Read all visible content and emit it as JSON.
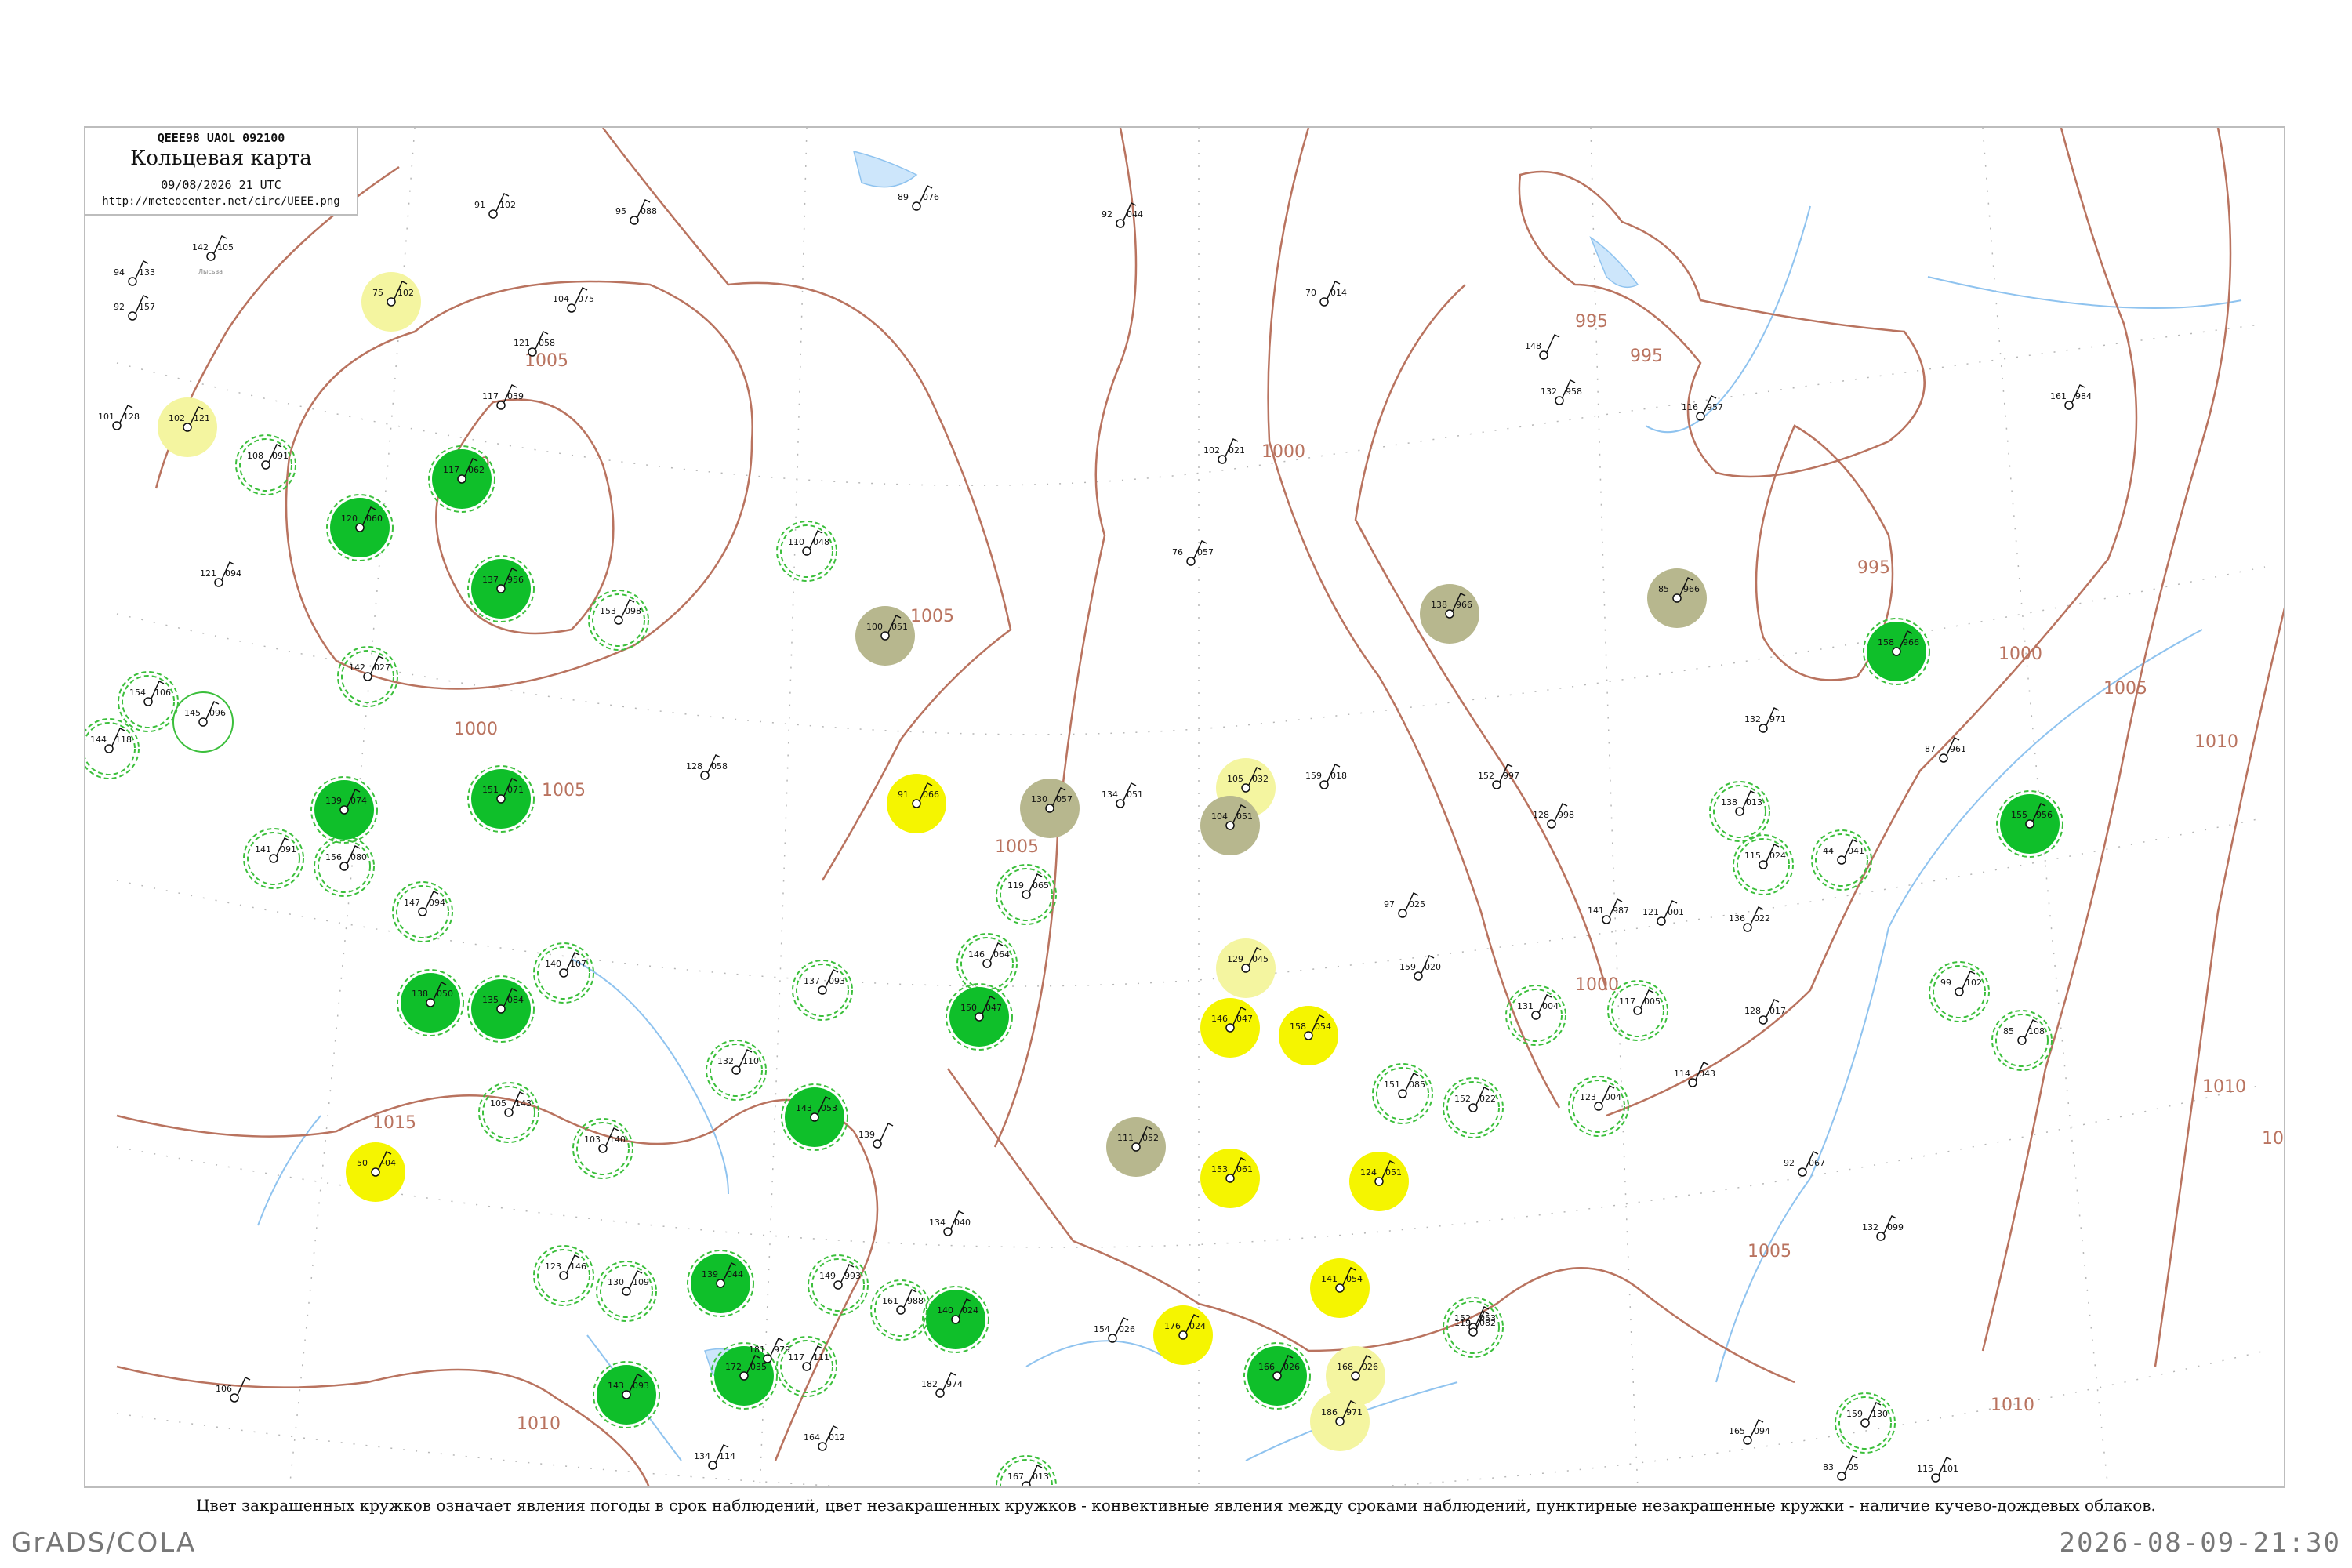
{
  "header": {
    "code_line": "QEEE98  UAOL  092100",
    "title": "Кольцевая карта",
    "date": "09/08/2026 21 UTC",
    "url": "http://meteocenter.net/circ/UEEE.png"
  },
  "caption": "Цвет закрашенных кружков означает явления погоды в срок наблюдений, цвет незакрашенных кружков - конвективные явления между сроками наблюдений, пунктирные незакрашенные кружки - наличие кучево-дождевых облаков.",
  "footer": {
    "left": "GrADS/COLA",
    "right": "2026-08-09-21:30"
  },
  "colors": {
    "isobar": "#b9735f",
    "river": "#8fc3ef",
    "rain_green": "#0fbf2a",
    "fog_olive": "#b7b78e",
    "haze_yellow": "#f5f500",
    "pale_yellow": "#f4f5a0",
    "convective_ring": "#3cbf3c"
  },
  "isobar_labels": [
    "1005",
    "1000",
    "1000",
    "1005",
    "1005",
    "1005",
    "1000",
    "1000",
    "995",
    "995",
    "995",
    "1000",
    "1005",
    "1010",
    "1015",
    "1010",
    "1010",
    "1005",
    "1010",
    "101"
  ],
  "stations": [
    {
      "t": "91",
      "p": "102",
      "name": "",
      "kind": "none"
    },
    {
      "t": "95",
      "p": "088",
      "name": "",
      "kind": "none"
    },
    {
      "t": "89",
      "p": "076",
      "name": "",
      "kind": "none"
    },
    {
      "t": "92",
      "p": "044",
      "name": "",
      "kind": "none"
    },
    {
      "t": "142",
      "p": "105",
      "name": "Лысьва",
      "kind": "none"
    },
    {
      "t": "94",
      "p": "133",
      "name": "",
      "kind": "none"
    },
    {
      "t": "92",
      "p": "157",
      "name": "",
      "kind": "none"
    },
    {
      "t": "75",
      "p": "102",
      "name": "",
      "kind": "yellow-pale"
    },
    {
      "t": "104",
      "p": "075",
      "name": "",
      "kind": "none"
    },
    {
      "t": "121",
      "p": "058",
      "name": "",
      "kind": "none"
    },
    {
      "t": "70",
      "p": "014",
      "name": "",
      "kind": "none"
    },
    {
      "t": "148",
      "p": "",
      "name": "",
      "kind": "none"
    },
    {
      "t": "132",
      "p": "958",
      "name": "",
      "kind": "none"
    },
    {
      "t": "116",
      "p": "957",
      "name": "",
      "kind": "none"
    },
    {
      "t": "161",
      "p": "984",
      "name": "",
      "kind": "none"
    },
    {
      "t": "101",
      "p": "128",
      "name": "",
      "kind": "none"
    },
    {
      "t": "102",
      "p": "121",
      "name": "",
      "kind": "yellow-pale"
    },
    {
      "t": "108",
      "p": "091",
      "name": "",
      "kind": "ring-dash"
    },
    {
      "t": "117",
      "p": "039",
      "name": "",
      "kind": "none"
    },
    {
      "t": "117",
      "p": "062",
      "name": "",
      "kind": "green"
    },
    {
      "t": "120",
      "p": "060",
      "name": "",
      "kind": "green"
    },
    {
      "t": "137",
      "p": "956",
      "name": "",
      "kind": "green"
    },
    {
      "t": "110",
      "p": "048",
      "name": "",
      "kind": "ring-dash"
    },
    {
      "t": "100",
      "p": "051",
      "name": "",
      "kind": "olive"
    },
    {
      "t": "76",
      "p": "057",
      "name": "",
      "kind": "none"
    },
    {
      "t": "102",
      "p": "021",
      "name": "",
      "kind": "none"
    },
    {
      "t": "138",
      "p": "966",
      "name": "",
      "kind": "olive"
    },
    {
      "t": "85",
      "p": "966",
      "name": "",
      "kind": "olive"
    },
    {
      "t": "158",
      "p": "966",
      "name": "",
      "kind": "green"
    },
    {
      "t": "153",
      "p": "098",
      "name": "",
      "kind": "ring-dash"
    },
    {
      "t": "121",
      "p": "094",
      "name": "",
      "kind": "none"
    },
    {
      "t": "142",
      "p": "027",
      "name": "",
      "kind": "ring-dash"
    },
    {
      "t": "145",
      "p": "096",
      "name": "",
      "kind": "ring"
    },
    {
      "t": "144",
      "p": "118",
      "name": "",
      "kind": "ring-dash"
    },
    {
      "t": "154",
      "p": "106",
      "name": "",
      "kind": "ring-dash"
    },
    {
      "t": "128",
      "p": "058",
      "name": "",
      "kind": "none"
    },
    {
      "t": "91",
      "p": "066",
      "name": "",
      "kind": "yellow"
    },
    {
      "t": "130",
      "p": "057",
      "name": "",
      "kind": "olive"
    },
    {
      "t": "134",
      "p": "051",
      "name": "",
      "kind": "none"
    },
    {
      "t": "105",
      "p": "032",
      "name": "",
      "kind": "yellow-pale"
    },
    {
      "t": "104",
      "p": "051",
      "name": "",
      "kind": "olive"
    },
    {
      "t": "159",
      "p": "018",
      "name": "",
      "kind": "none"
    },
    {
      "t": "152",
      "p": "997",
      "name": "",
      "kind": "none"
    },
    {
      "t": "132",
      "p": "971",
      "name": "",
      "kind": "none"
    },
    {
      "t": "87",
      "p": "961",
      "name": "",
      "kind": "none"
    },
    {
      "t": "128",
      "p": "998",
      "name": "",
      "kind": "none"
    },
    {
      "t": "138",
      "p": "013",
      "name": "",
      "kind": "ring-dash"
    },
    {
      "t": "115",
      "p": "024",
      "name": "",
      "kind": "ring-dash"
    },
    {
      "t": "44",
      "p": "041",
      "name": "",
      "kind": "ring-dash"
    },
    {
      "t": "155",
      "p": "956",
      "name": "",
      "kind": "green"
    },
    {
      "t": "151",
      "p": "071",
      "name": "",
      "kind": "green"
    },
    {
      "t": "141",
      "p": "091",
      "name": "",
      "kind": "ring-dash"
    },
    {
      "t": "156",
      "p": "080",
      "name": "",
      "kind": "ring-dash"
    },
    {
      "t": "139",
      "p": "074",
      "name": "",
      "kind": "green"
    },
    {
      "t": "147",
      "p": "094",
      "name": "",
      "kind": "ring-dash"
    },
    {
      "t": "119",
      "p": "065",
      "name": "",
      "kind": "ring-dash"
    },
    {
      "t": "146",
      "p": "064",
      "name": "",
      "kind": "ring-dash"
    },
    {
      "t": "129",
      "p": "045",
      "name": "",
      "kind": "yellow-pale"
    },
    {
      "t": "159",
      "p": "020",
      "name": "",
      "kind": "none"
    },
    {
      "t": "97",
      "p": "025",
      "name": "",
      "kind": "none"
    },
    {
      "t": "141",
      "p": "987",
      "name": "",
      "kind": "none"
    },
    {
      "t": "121",
      "p": "001",
      "name": "",
      "kind": "none"
    },
    {
      "t": "136",
      "p": "022",
      "name": "",
      "kind": "none"
    },
    {
      "t": "99",
      "p": "102",
      "name": "",
      "kind": "ring-dash"
    },
    {
      "t": "140",
      "p": "107",
      "name": "",
      "kind": "ring-dash"
    },
    {
      "t": "138",
      "p": "050",
      "name": "",
      "kind": "green"
    },
    {
      "t": "135",
      "p": "084",
      "name": "",
      "kind": "green"
    },
    {
      "t": "137",
      "p": "093",
      "name": "",
      "kind": "ring-dash"
    },
    {
      "t": "150",
      "p": "047",
      "name": "",
      "kind": "green"
    },
    {
      "t": "146",
      "p": "047",
      "name": "",
      "kind": "yellow"
    },
    {
      "t": "158",
      "p": "054",
      "name": "",
      "kind": "yellow"
    },
    {
      "t": "131",
      "p": "004",
      "name": "",
      "kind": "ring-dash"
    },
    {
      "t": "117",
      "p": "005",
      "name": "",
      "kind": "ring-dash"
    },
    {
      "t": "128",
      "p": "017",
      "name": "",
      "kind": "none"
    },
    {
      "t": "85",
      "p": "108",
      "name": "",
      "kind": "ring-dash"
    },
    {
      "t": "132",
      "p": "110",
      "name": "",
      "kind": "ring-dash"
    },
    {
      "t": "143",
      "p": "053",
      "name": "",
      "kind": "green"
    },
    {
      "t": "151",
      "p": "085",
      "name": "",
      "kind": "ring-dash"
    },
    {
      "t": "152",
      "p": "022",
      "name": "",
      "kind": "ring-dash"
    },
    {
      "t": "123",
      "p": "004",
      "name": "",
      "kind": "ring-dash"
    },
    {
      "t": "114",
      "p": "043",
      "name": "",
      "kind": "none"
    },
    {
      "t": "105",
      "p": "143",
      "name": "",
      "kind": "ring-dash"
    },
    {
      "t": "103",
      "p": "140",
      "name": "",
      "kind": "ring-dash"
    },
    {
      "t": "111",
      "p": "052",
      "name": "",
      "kind": "olive"
    },
    {
      "t": "153",
      "p": "061",
      "name": "",
      "kind": "yellow"
    },
    {
      "t": "124",
      "p": "051",
      "name": "",
      "kind": "yellow"
    },
    {
      "t": "92",
      "p": "067",
      "name": "",
      "kind": "none"
    },
    {
      "t": "132",
      "p": "099",
      "name": "",
      "kind": "none"
    },
    {
      "t": "50",
      "p": "-04",
      "name": "",
      "kind": "yellow"
    },
    {
      "t": "139",
      "p": "",
      "name": "",
      "kind": "none"
    },
    {
      "t": "134",
      "p": "040",
      "name": "",
      "kind": "none"
    },
    {
      "t": "123",
      "p": "146",
      "name": "",
      "kind": "ring-dash"
    },
    {
      "t": "130",
      "p": "109",
      "name": "",
      "kind": "ring-dash"
    },
    {
      "t": "139",
      "p": "044",
      "name": "",
      "kind": "green"
    },
    {
      "t": "149",
      "p": "993",
      "name": "",
      "kind": "ring-dash"
    },
    {
      "t": "161",
      "p": "988",
      "name": "",
      "kind": "ring-dash"
    },
    {
      "t": "141",
      "p": "054",
      "name": "",
      "kind": "yellow"
    },
    {
      "t": "152",
      "p": "053",
      "name": "",
      "kind": "ring-dash"
    },
    {
      "t": "119",
      "p": "082",
      "name": "",
      "kind": "none"
    },
    {
      "t": "140",
      "p": "024",
      "name": "",
      "kind": "green"
    },
    {
      "t": "154",
      "p": "026",
      "name": "",
      "kind": "none"
    },
    {
      "t": "176",
      "p": "024",
      "name": "",
      "kind": "yellow"
    },
    {
      "t": "166",
      "p": "026",
      "name": "",
      "kind": "green"
    },
    {
      "t": "168",
      "p": "026",
      "name": "",
      "kind": "yellow-pale"
    },
    {
      "t": "186",
      "p": "971",
      "name": "",
      "kind": "yellow-pale"
    },
    {
      "t": "182",
      "p": "974",
      "name": "",
      "kind": "none"
    },
    {
      "t": "117",
      "p": "111",
      "name": "",
      "kind": "ring-dash"
    },
    {
      "t": "143",
      "p": "093",
      "name": "",
      "kind": "green"
    },
    {
      "t": "172",
      "p": "035",
      "name": "",
      "kind": "green"
    },
    {
      "t": "181",
      "p": "979",
      "name": "",
      "kind": "none"
    },
    {
      "t": "164",
      "p": "012",
      "name": "",
      "kind": "none"
    },
    {
      "t": "167",
      "p": "013",
      "name": "",
      "kind": "ring-dash"
    },
    {
      "t": "134",
      "p": "114",
      "name": "",
      "kind": "none"
    },
    {
      "t": "159",
      "p": "130",
      "name": "",
      "kind": "ring-dash"
    },
    {
      "t": "115",
      "p": "101",
      "name": "",
      "kind": "none"
    },
    {
      "t": "165",
      "p": "094",
      "name": "",
      "kind": "none"
    },
    {
      "t": "83",
      "p": "05",
      "name": "",
      "kind": "none"
    },
    {
      "t": "106",
      "p": "",
      "name": "",
      "kind": "none"
    }
  ]
}
